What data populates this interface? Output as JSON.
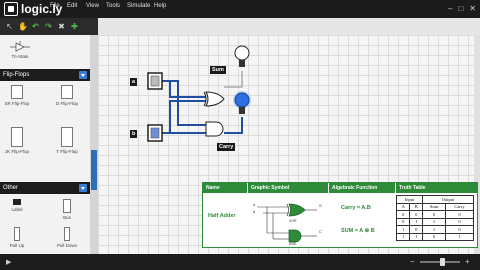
{
  "app": {
    "logo_text": "logic.ly"
  },
  "menu": [
    "File",
    "Edit",
    "View",
    "Tools",
    "Simulate",
    "Help"
  ],
  "toolbar": {
    "icons": [
      "pointer-icon",
      "hand-icon",
      "undo-icon",
      "redo-icon",
      "delete-icon",
      "add-icon"
    ]
  },
  "sidebar": {
    "top_item_label": "Tri-State",
    "sections": [
      {
        "title": "Flip-Flops",
        "items": [
          "SR Flip-Flop",
          "D Flip-Flop",
          "JK Flip-Flop",
          "T Flip-Flop"
        ]
      },
      {
        "title": "Other",
        "items": [
          "Label",
          "Bus",
          "Pull Up",
          "Pull Down"
        ]
      }
    ]
  },
  "circuit": {
    "input_labels": [
      "a",
      "b"
    ],
    "output_labels": [
      "Sum",
      "Carry"
    ]
  },
  "half_adder_panel": {
    "headers": [
      "Name",
      "Graphic Symbol",
      "Algebraic Function",
      "Truth Table"
    ],
    "name": "Half Adder",
    "gate_labels": [
      "XOR",
      "AND"
    ],
    "pin_labels": {
      "a": "a",
      "b": "b",
      "s": "S",
      "c": "C"
    },
    "carry_eq": "Carry = A.B",
    "sum_eq": "SUM = A ⊕ B",
    "truth_table": {
      "group_input": "Input",
      "group_output": "Output",
      "columns": [
        "A",
        "B",
        "Sum",
        "Carry"
      ],
      "rows": [
        [
          "0",
          "0",
          "0",
          "0"
        ],
        [
          "0",
          "1",
          "1",
          "0"
        ],
        [
          "1",
          "0",
          "1",
          "0"
        ],
        [
          "1",
          "1",
          "0",
          "1"
        ]
      ]
    }
  }
}
